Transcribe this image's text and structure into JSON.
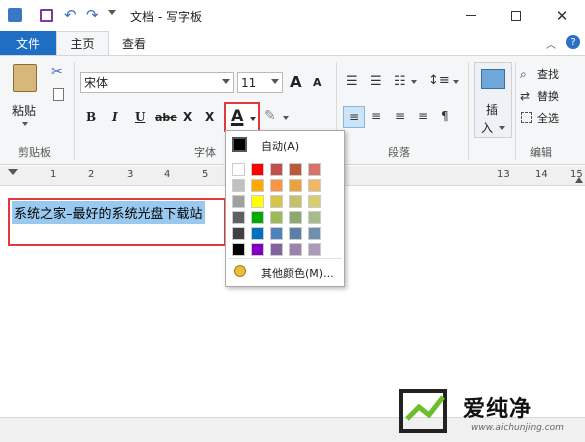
{
  "window": {
    "title": "文档 - 写字板",
    "controls": [
      "minimize-icon",
      "maximize-icon",
      "close-icon"
    ]
  },
  "tabs": {
    "file": "文件",
    "home": "主页",
    "view": "查看"
  },
  "clipboard": {
    "paste_label": "粘贴",
    "group_label": "剪贴板"
  },
  "font": {
    "family_value": "宋体",
    "size_value": "11",
    "group_label": "字体",
    "grow_icon": "A",
    "shrink_icon": "A",
    "bold": "B",
    "italic": "I",
    "underline": "U",
    "strike": "abc",
    "subscript": "X",
    "superscript": "X",
    "color_letter": "A"
  },
  "paragraph": {
    "group_label": "段落"
  },
  "insert": {
    "label": "插",
    "label2": "入"
  },
  "edit": {
    "find": "查找",
    "replace": "替换",
    "select_all": "全选",
    "group_label": "编辑"
  },
  "ruler": {
    "marks": [
      "1",
      "2",
      "3",
      "4",
      "5",
      "13",
      "14",
      "15"
    ]
  },
  "document": {
    "text": "系统之家–最好的系统光盘下载站"
  },
  "color_menu": {
    "auto_label": "自动(A)",
    "more_label": "其他颜色(M)...",
    "accent_border": "#e03a3a",
    "columns": [
      [
        "#ffffff",
        "#c0c0c0",
        "#a0a0a0",
        "#606060",
        "#404040",
        "#000000"
      ],
      [
        "#ff0000",
        "#ffaa00",
        "#ffff00",
        "#00aa00",
        "#0070c0",
        "#8000c0"
      ],
      [
        "#c0504d",
        "#f79646",
        "#d5c54a",
        "#9bbb59",
        "#4f81bd",
        "#8064a2"
      ],
      [
        "#b85a3a",
        "#e8a33d",
        "#c6c06a",
        "#8ea870",
        "#5b7fa6",
        "#9a84ac"
      ],
      [
        "#d9736a",
        "#f0b864",
        "#d9cd72",
        "#a6bd8a",
        "#6f8fb0",
        "#ab9ab8"
      ]
    ]
  },
  "watermark": {
    "text": "爱纯净",
    "url": "www.aichunjing.com"
  }
}
